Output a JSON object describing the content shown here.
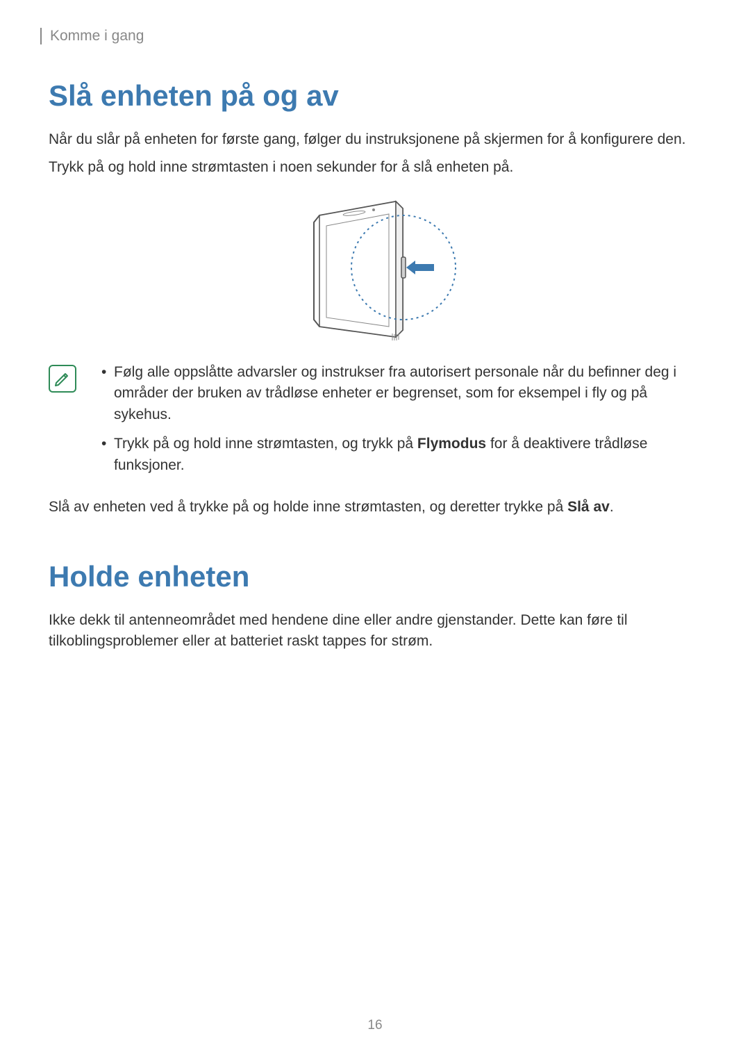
{
  "header": {
    "section_label": "Komme i gang"
  },
  "section1": {
    "title": "Slå enheten på og av",
    "para1": "Når du slår på enheten for første gang, følger du instruksjonene på skjermen for å konfigurere den.",
    "para2": "Trykk på og hold inne strømtasten i noen sekunder for å slå enheten på."
  },
  "note": {
    "items": [
      {
        "text": "Følg alle oppslåtte advarsler og instrukser fra autorisert personale når du befinner deg i områder der bruken av trådløse enheter er begrenset, som for eksempel i fly og på sykehus."
      },
      {
        "prefix": "Trykk på og hold inne strømtasten, og trykk på ",
        "bold": "Flymodus",
        "suffix": " for å deaktivere trådløse funksjoner."
      }
    ]
  },
  "section1b": {
    "para_prefix": "Slå av enheten ved å trykke på og holde inne strømtasten, og deretter trykke på ",
    "para_bold": "Slå av",
    "para_suffix": "."
  },
  "section2": {
    "title": "Holde enheten",
    "para1": "Ikke dekk til antenneområdet med hendene dine eller andre gjenstander. Dette kan føre til tilkoblingsproblemer eller at batteriet raskt tappes for strøm."
  },
  "page_number": "16"
}
